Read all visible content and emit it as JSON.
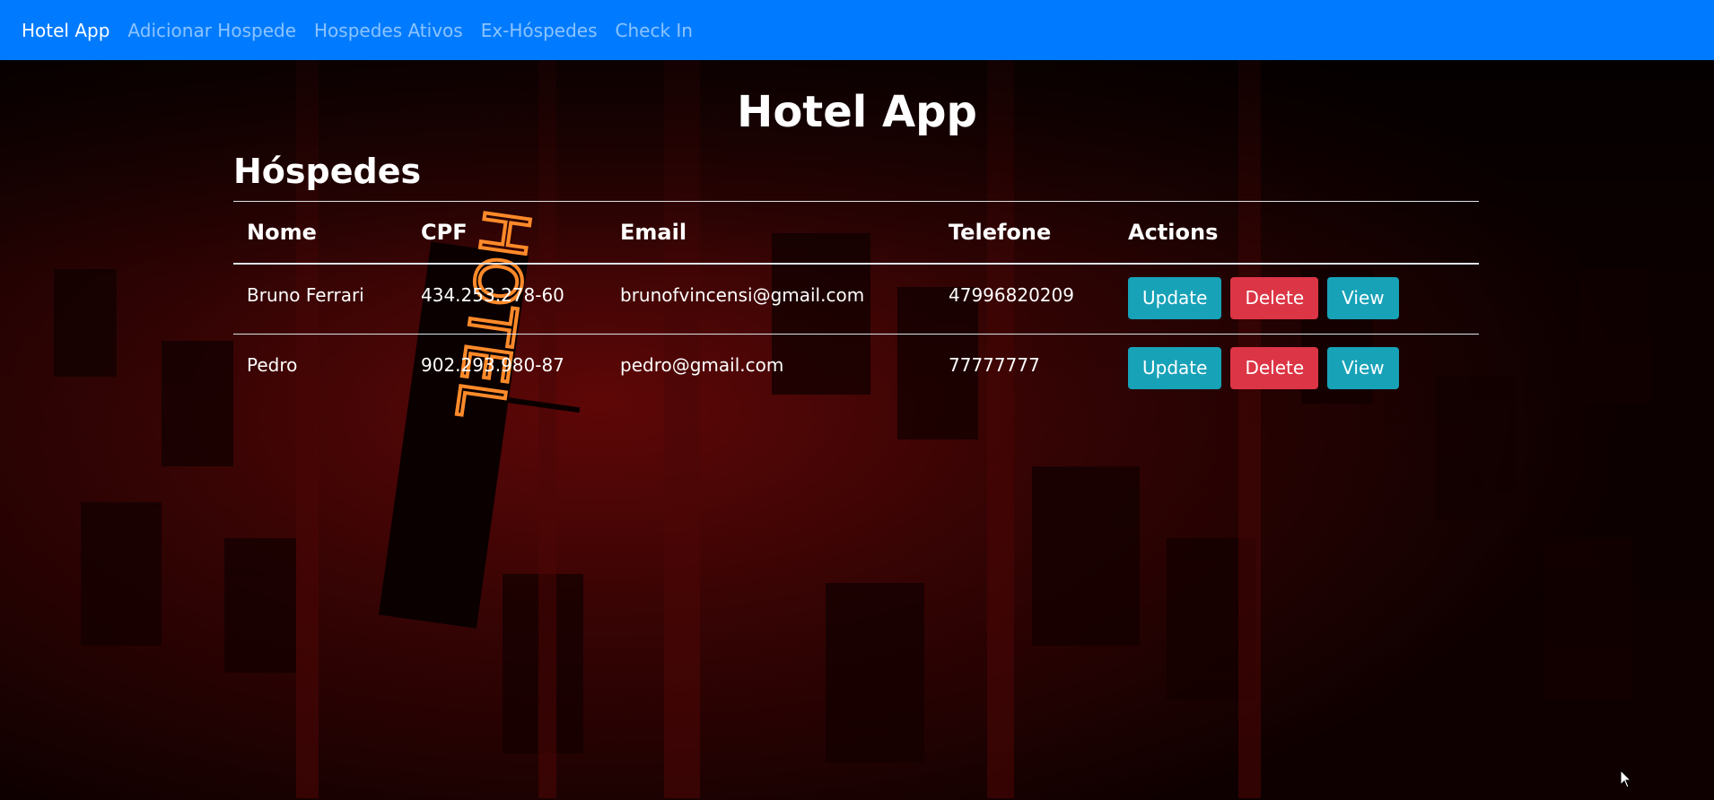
{
  "navbar": {
    "brand": "Hotel App",
    "links": [
      "Adicionar Hospede",
      "Hospedes Ativos",
      "Ex-Hóspedes",
      "Check In"
    ],
    "color": "#007bff"
  },
  "main": {
    "title": "Hotel App",
    "section_title": "Hóspedes",
    "table": {
      "headers": [
        "Nome",
        "CPF",
        "Email",
        "Telefone",
        "Actions"
      ],
      "rows": [
        {
          "nome": "Bruno Ferrari",
          "cpf": "434.253.278-60",
          "email": "brunofvincensi@gmail.com",
          "telefone": "47996820209"
        },
        {
          "nome": "Pedro",
          "cpf": "902.293.980-87",
          "email": "pedro@gmail.com",
          "telefone": "77777777"
        }
      ],
      "actions": {
        "update": "Update",
        "delete": "Delete",
        "view": "View"
      }
    }
  },
  "colors": {
    "info": "#17a2b8",
    "danger": "#dc3545",
    "background": "#3a0000"
  },
  "icons": {
    "background": "hotel-neon-sign-photo",
    "cursor": "mouse-pointer-icon"
  }
}
